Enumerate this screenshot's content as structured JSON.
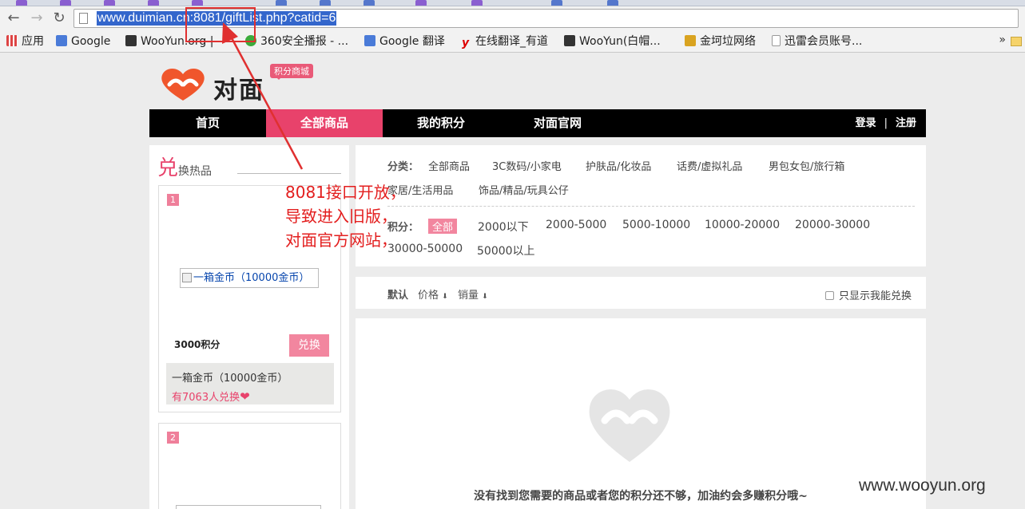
{
  "browser": {
    "url": "www.duimian.cn:8081/giftList.php?catid=6",
    "bookmarks": [
      {
        "label": "应用",
        "icon": "apps-grid-icon"
      },
      {
        "label": "Google",
        "icon": "google-icon"
      },
      {
        "label": "WooYun.org |",
        "icon": "wooyun-icon"
      },
      {
        "label": "360安全播报 - ...",
        "icon": "360-icon"
      },
      {
        "label": "Google 翻译",
        "icon": "translate-icon"
      },
      {
        "label": "在线翻译_有道",
        "icon": "youdao-icon"
      },
      {
        "label": "WooYun(白帽...",
        "icon": "wooyun-icon"
      },
      {
        "label": "金坷垃网络",
        "icon": "jinkela-icon"
      },
      {
        "label": "迅雷会员账号...",
        "icon": "page-icon"
      }
    ],
    "more_label": "»"
  },
  "site": {
    "logo_text": "对面",
    "logo_badge": "积分商城",
    "nav": [
      "首页",
      "全部商品",
      "我的积分",
      "对面官网"
    ],
    "login": "登录",
    "separator": "|",
    "register": "注册"
  },
  "hot": {
    "title_big": "兑",
    "title_rest": "换热品",
    "items": [
      {
        "rank": "1",
        "image_alt": "一箱金币（10000金币）",
        "points": "3000积分",
        "button": "兑换",
        "name": "一箱金币（10000金币）",
        "count": "有7063人兑换"
      },
      {
        "rank": "2"
      }
    ]
  },
  "filters": {
    "category_label": "分类：",
    "categories": [
      "全部商品",
      "3C数码/小家电",
      "护肤品/化妆品",
      "话费/虚拟礼品",
      "男包女包/旅行箱",
      "家居/生活用品",
      "饰品/精品/玩具公仔"
    ],
    "points_label": "积分：",
    "points": [
      "全部",
      "2000以下",
      "2000-5000",
      "5000-10000",
      "10000-20000",
      "20000-30000",
      "30000-50000",
      "50000以上"
    ]
  },
  "sort": {
    "default": "默认",
    "price": "价格",
    "sales": "销量",
    "only_mine": "只显示我能兑换"
  },
  "empty_message": "没有找到您需要的商品或者您的积分还不够，加油约会多赚积分哦~",
  "annotation": {
    "lines": [
      "8081接口开放，",
      "导致进入旧版，",
      "对面官方网站，"
    ],
    "color": "#e31e1e"
  },
  "watermark": "www.wooyun.org",
  "colors": {
    "accent": "#e8426b",
    "button": "#f2869f",
    "nav_bg": "#000000"
  }
}
